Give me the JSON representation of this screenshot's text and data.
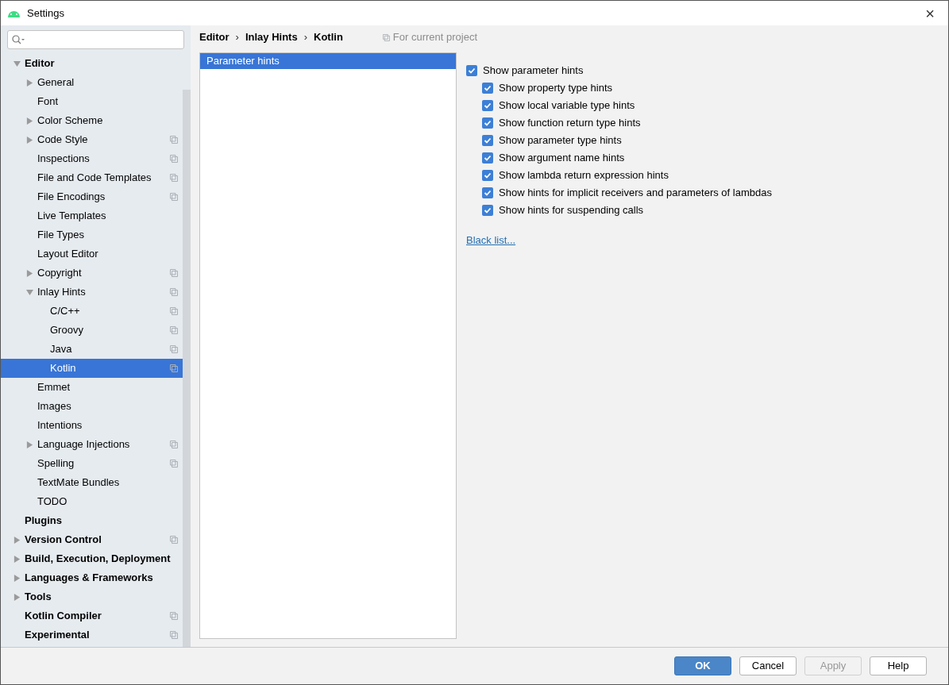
{
  "window": {
    "title": "Settings",
    "close": "×"
  },
  "tree": [
    {
      "label": "Editor",
      "expanded": true,
      "selected": false,
      "project": false,
      "children": [
        {
          "label": "General",
          "expanded": false,
          "selected": false,
          "project": false
        },
        {
          "label": "Font",
          "selected": false,
          "project": false
        },
        {
          "label": "Color Scheme",
          "expanded": false,
          "selected": false,
          "project": false
        },
        {
          "label": "Code Style",
          "expanded": false,
          "selected": false,
          "project": true
        },
        {
          "label": "Inspections",
          "selected": false,
          "project": true
        },
        {
          "label": "File and Code Templates",
          "selected": false,
          "project": true
        },
        {
          "label": "File Encodings",
          "selected": false,
          "project": true
        },
        {
          "label": "Live Templates",
          "selected": false,
          "project": false
        },
        {
          "label": "File Types",
          "selected": false,
          "project": false
        },
        {
          "label": "Layout Editor",
          "selected": false,
          "project": false
        },
        {
          "label": "Copyright",
          "expanded": false,
          "selected": false,
          "project": true
        },
        {
          "label": "Inlay Hints",
          "expanded": true,
          "selected": false,
          "project": true,
          "children": [
            {
              "label": "C/C++",
              "selected": false,
              "project": true
            },
            {
              "label": "Groovy",
              "selected": false,
              "project": true
            },
            {
              "label": "Java",
              "selected": false,
              "project": true
            },
            {
              "label": "Kotlin",
              "selected": true,
              "project": true
            }
          ]
        },
        {
          "label": "Emmet",
          "selected": false,
          "project": false
        },
        {
          "label": "Images",
          "selected": false,
          "project": false
        },
        {
          "label": "Intentions",
          "selected": false,
          "project": false
        },
        {
          "label": "Language Injections",
          "expanded": false,
          "selected": false,
          "project": true
        },
        {
          "label": "Spelling",
          "selected": false,
          "project": true
        },
        {
          "label": "TextMate Bundles",
          "selected": false,
          "project": false
        },
        {
          "label": "TODO",
          "selected": false,
          "project": false
        }
      ]
    },
    {
      "label": "Plugins",
      "selected": false,
      "project": false
    },
    {
      "label": "Version Control",
      "expanded": false,
      "selected": false,
      "project": true
    },
    {
      "label": "Build, Execution, Deployment",
      "expanded": false,
      "selected": false,
      "project": false
    },
    {
      "label": "Languages & Frameworks",
      "expanded": false,
      "selected": false,
      "project": false
    },
    {
      "label": "Tools",
      "expanded": false,
      "selected": false,
      "project": false
    },
    {
      "label": "Kotlin Compiler",
      "selected": false,
      "project": true
    },
    {
      "label": "Experimental",
      "selected": false,
      "project": true
    }
  ],
  "breadcrumb": {
    "items": [
      "Editor",
      "Inlay Hints",
      "Kotlin"
    ],
    "separator": "›",
    "scope": "For current project"
  },
  "hint_types": [
    {
      "label": "Parameter hints",
      "selected": true
    }
  ],
  "options": [
    {
      "label": "Show parameter hints",
      "checked": true,
      "children": [
        {
          "label": "Show property type hints",
          "checked": true
        },
        {
          "label": "Show local variable type hints",
          "checked": true
        },
        {
          "label": "Show function return type hints",
          "checked": true
        },
        {
          "label": "Show parameter type hints",
          "checked": true
        },
        {
          "label": "Show argument name hints",
          "checked": true
        },
        {
          "label": "Show lambda return expression hints",
          "checked": true
        },
        {
          "label": "Show hints for implicit receivers and parameters of lambdas",
          "checked": true
        },
        {
          "label": "Show hints for suspending calls",
          "checked": true
        }
      ]
    }
  ],
  "black_list_link": "Black list...",
  "buttons": [
    {
      "label": "OK",
      "kind": "primary",
      "disabled": false
    },
    {
      "label": "Cancel",
      "kind": "normal",
      "disabled": false
    },
    {
      "label": "Apply",
      "kind": "normal",
      "disabled": true
    },
    {
      "label": "Help",
      "kind": "normal",
      "disabled": false
    }
  ]
}
